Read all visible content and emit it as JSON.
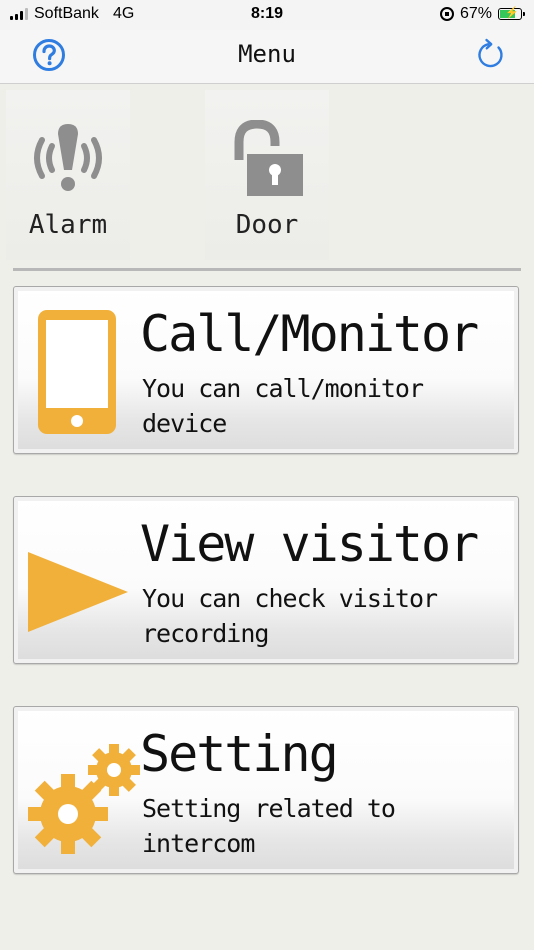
{
  "status_bar": {
    "carrier": "SoftBank",
    "network": "4G",
    "time": "8:19",
    "battery_percent": "67%",
    "battery_level": 0.67
  },
  "nav": {
    "title": "Menu",
    "help_icon": "question-circle-icon",
    "refresh_icon": "refresh-icon"
  },
  "tiles": [
    {
      "label": "Alarm",
      "icon": "alarm-icon"
    },
    {
      "label": "Door",
      "icon": "unlock-icon"
    }
  ],
  "menu": [
    {
      "title": "Call/Monitor",
      "description": "You can call/monitor device",
      "icon": "phone-icon"
    },
    {
      "title": "View visitor",
      "description": "You can check visitor recording",
      "icon": "play-icon"
    },
    {
      "title": "Setting",
      "description": "Setting related to intercom",
      "icon": "gears-icon"
    }
  ],
  "colors": {
    "accent_blue": "#2f7de1",
    "icon_orange": "#f1b03a",
    "icon_gray": "#8e8e8e"
  }
}
